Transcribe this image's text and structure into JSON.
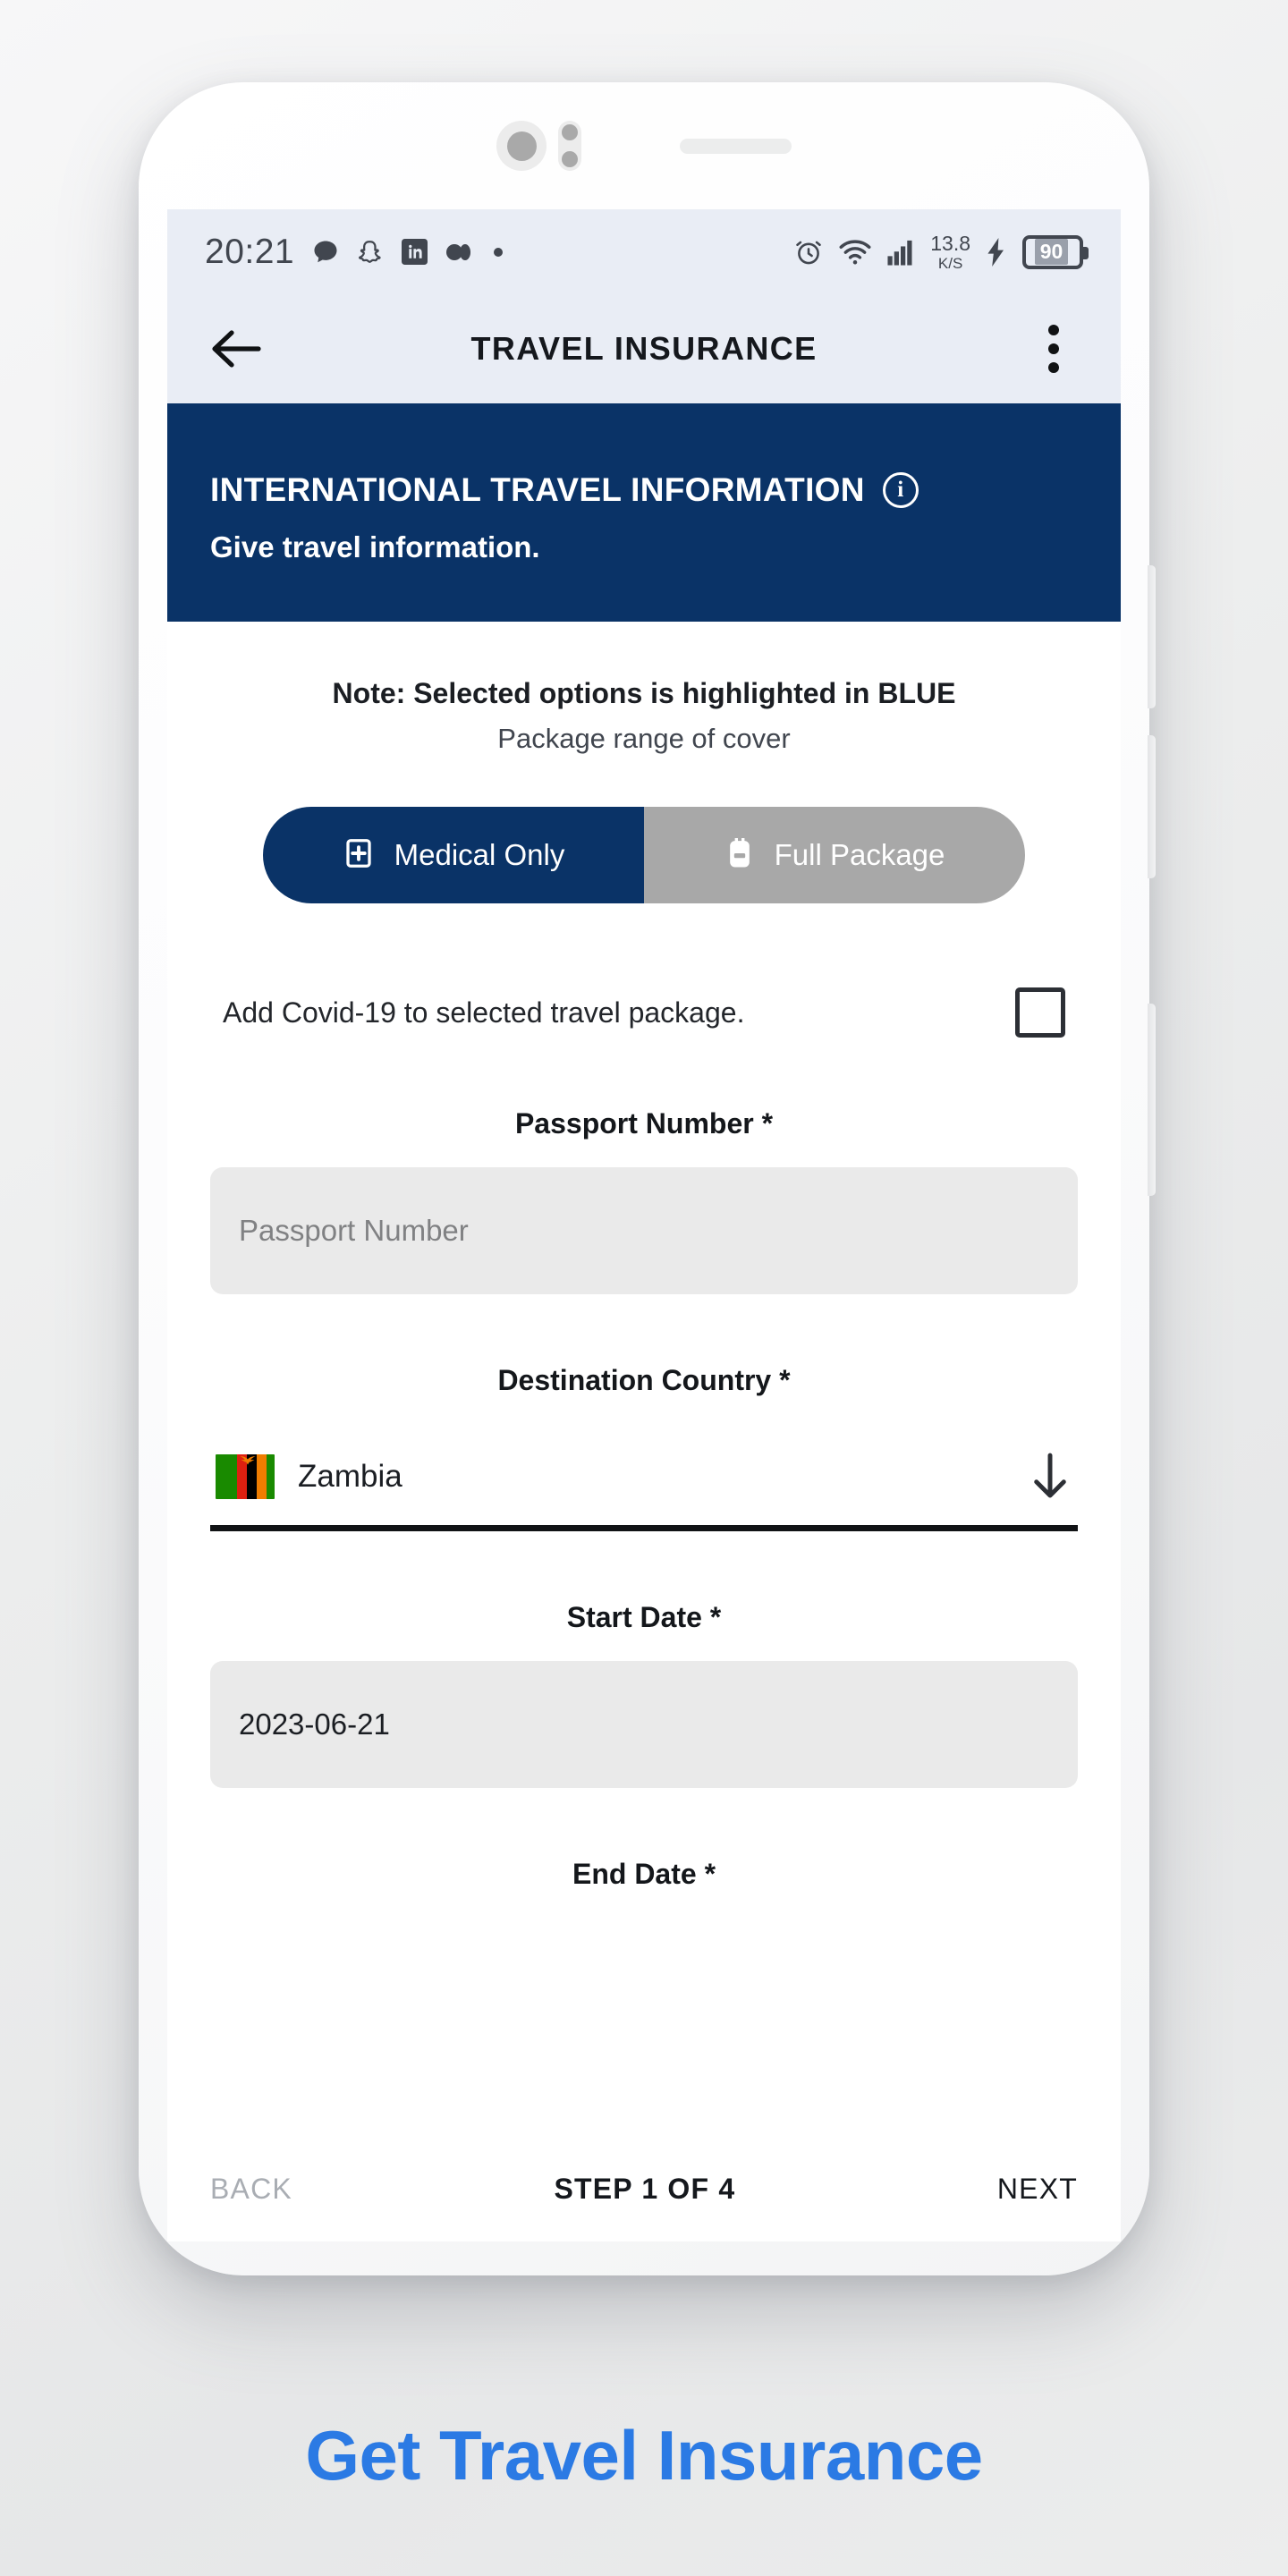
{
  "colors": {
    "brand_navy": "#0a3367",
    "segment_inactive_gray": "#a8a8a8",
    "status_bar_bg": "#e9edf5",
    "field_bg": "#eaeaea",
    "caption_blue": "#2b7ae4"
  },
  "status_bar": {
    "time": "20:21",
    "notification_icons": [
      "chat-bubble-icon",
      "snapchat-icon",
      "linkedin-icon",
      "media-icon",
      "dot-icon"
    ],
    "right_icons": [
      "alarm-icon",
      "wifi-icon",
      "signal-bars-icon",
      "charging-bolt-icon"
    ],
    "network_speed": "13.8",
    "network_speed_unit": "K/S",
    "battery_level": "90"
  },
  "app_bar": {
    "title": "TRAVEL INSURANCE",
    "back_icon": "back-arrow-icon",
    "menu_icon": "overflow-menu-icon"
  },
  "hero": {
    "title": "INTERNATIONAL TRAVEL INFORMATION",
    "info_icon_label": "i",
    "subtitle": "Give travel information."
  },
  "note": {
    "line1": "Note: Selected options is highlighted in BLUE",
    "line2": "Package range of cover"
  },
  "package_toggle": {
    "options": [
      {
        "label": "Medical Only",
        "icon": "medical-kit-icon",
        "selected": true
      },
      {
        "label": "Full Package",
        "icon": "backpack-icon",
        "selected": false
      }
    ]
  },
  "covid": {
    "label": "Add Covid-19 to selected travel package.",
    "checked": false
  },
  "fields": {
    "passport": {
      "label": "Passport Number *",
      "placeholder": "Passport Number",
      "value": ""
    },
    "destination": {
      "label": "Destination Country *",
      "value": "Zambia",
      "flag": "zambia-flag-icon",
      "dropdown_icon": "down-arrow-icon"
    },
    "start_date": {
      "label": "Start Date *",
      "value": "2023-06-21"
    },
    "end_date": {
      "label": "End Date *"
    }
  },
  "step_bar": {
    "back_label": "BACK",
    "step_label": "STEP 1 OF 4",
    "next_label": "NEXT"
  },
  "caption": {
    "text": "Get Travel Insurance"
  }
}
